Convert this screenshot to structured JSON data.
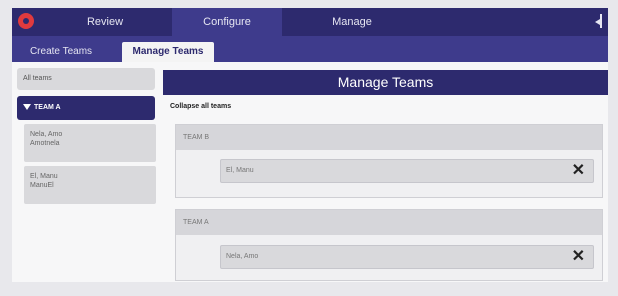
{
  "topnav": {
    "tabs": [
      {
        "label": "Review"
      },
      {
        "label": "Configure"
      },
      {
        "label": "Manage"
      }
    ]
  },
  "subnav": {
    "tabs": [
      {
        "label": "Create Teams"
      },
      {
        "label": "Manage Teams"
      }
    ]
  },
  "sidebar": {
    "all_teams": "All teams",
    "team_a": "TEAM A",
    "members": [
      {
        "line1": "Nela, Amo",
        "line2": "Amotnela"
      },
      {
        "line1": "El, Manu",
        "line2": "ManuEl"
      }
    ]
  },
  "main": {
    "title": "Manage Teams",
    "collapse_all": "Collapse all teams",
    "teams": [
      {
        "name": "TEAM B",
        "member": "El, Manu"
      },
      {
        "name": "TEAM A",
        "member": "Nela, Amo"
      }
    ],
    "remove_glyph": "✕"
  }
}
